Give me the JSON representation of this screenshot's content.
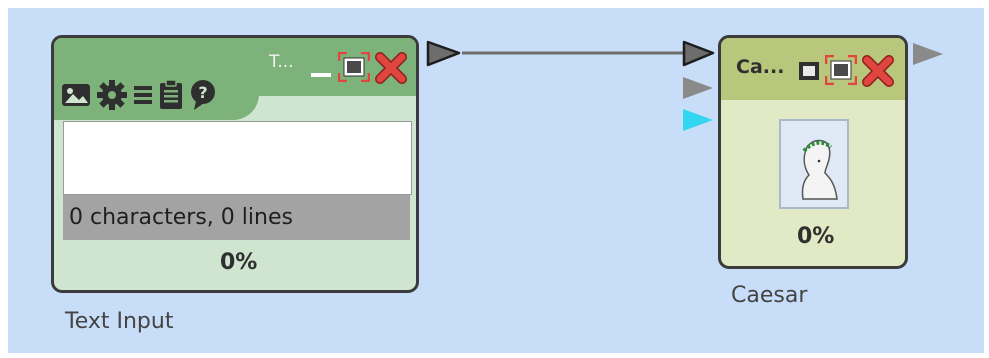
{
  "workflow": {
    "text_input_node": {
      "title": "T...",
      "status_text": "0 characters,  0 lines",
      "progress": "0%",
      "label": "Text Input",
      "text_value": "",
      "tools": [
        "image-icon",
        "gear-icon",
        "list-icon",
        "clipboard-icon",
        "help-icon"
      ]
    },
    "caesar_node": {
      "title": "Ca...",
      "progress": "0%",
      "label": "Caesar",
      "icon": "caesar-bust-icon"
    }
  },
  "colors": {
    "canvas_bg": "#c8ddf7",
    "text_node_title": "#7db37a",
    "text_node_body": "#cfe5cf",
    "caesar_title": "#b8c77c",
    "caesar_body": "#e2e9c5",
    "close_red": "#e0453f",
    "port_gray": "#7a7a7a",
    "port_cyan": "#33d6f0"
  }
}
